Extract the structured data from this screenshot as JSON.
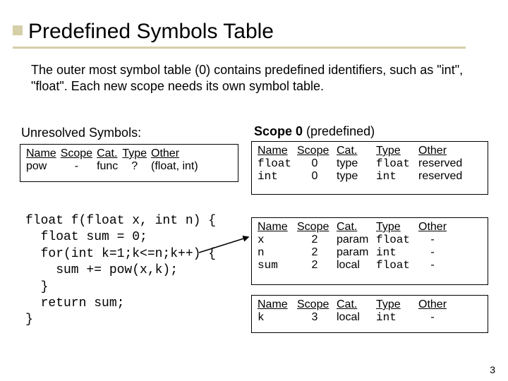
{
  "title": "Predefined Symbols Table",
  "intro": "The outer most symbol table (0) contains predefined identifiers, such as \"int\", \"float\".   Each new scope needs its own symbol table.",
  "pagenum": "3",
  "unresolved": {
    "heading": "Unresolved Symbols:",
    "headers": {
      "name": "Name",
      "scope": "Scope",
      "cat": "Cat.",
      "type": "Type",
      "other": "Other"
    },
    "rows": [
      {
        "name": "pow",
        "scope": "-",
        "cat": "func",
        "type": "?",
        "other": "(float, int)"
      }
    ]
  },
  "scope0": {
    "heading_prefix": "Scope 0 ",
    "heading_suffix": "(predefined)",
    "headers": {
      "name": "Name",
      "scope": "Scope",
      "cat": "Cat.",
      "type": "Type",
      "other": "Other"
    },
    "rows": [
      {
        "name": "float",
        "scope": "0",
        "cat": "type",
        "type": "float",
        "other": "reserved"
      },
      {
        "name": "int",
        "scope": "0",
        "cat": "type",
        "type": "int",
        "other": "reserved"
      }
    ]
  },
  "scope2": {
    "headers": {
      "name": "Name",
      "scope": "Scope",
      "cat": "Cat.",
      "type": "Type",
      "other": "Other"
    },
    "rows": [
      {
        "name": "x",
        "scope": "2",
        "cat": "param",
        "type": "float",
        "other": "-"
      },
      {
        "name": "n",
        "scope": "2",
        "cat": "param",
        "type": "int",
        "other": "-"
      },
      {
        "name": "sum",
        "scope": "2",
        "cat": "local",
        "type": "float",
        "other": "-"
      }
    ]
  },
  "scope3": {
    "headers": {
      "name": "Name",
      "scope": "Scope",
      "cat": "Cat.",
      "type": "Type",
      "other": "Other"
    },
    "rows": [
      {
        "name": "k",
        "scope": "3",
        "cat": "local",
        "type": "int",
        "other": "-"
      }
    ]
  },
  "code": {
    "l0": "float f(float x, int n) {",
    "l1": "  float sum = 0;",
    "l2": "  for(int k=1;k<=n;k++) {",
    "l3": "    sum += pow(x,k);",
    "l4": "  }",
    "l5": "  return sum;",
    "l6": "}"
  }
}
